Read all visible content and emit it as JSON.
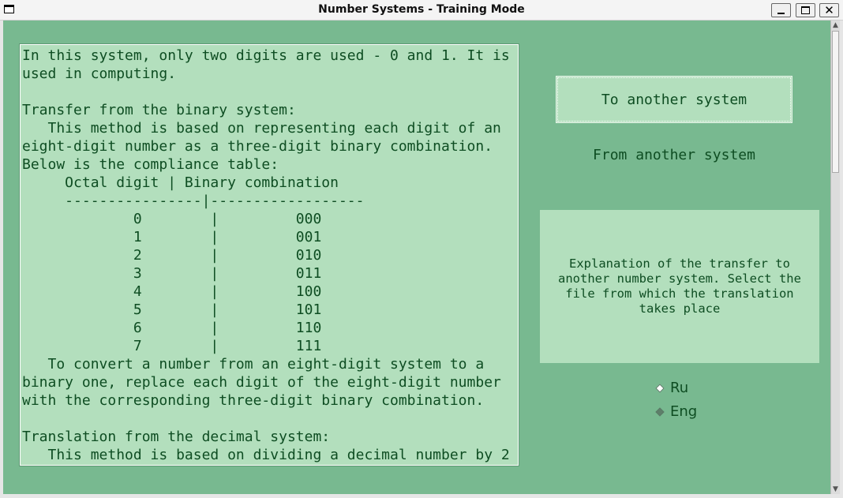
{
  "window": {
    "title": "Number Systems - Training Mode",
    "close_glyph": "✕"
  },
  "content": {
    "text": "In this system, only two digits are used - 0 and 1. It is\nused in computing.\n\nTransfer from the binary system:\n   This method is based on representing each digit of an\neight-digit number as a three-digit binary combination.\nBelow is the compliance table:\n     Octal digit | Binary combination\n     ----------------|------------------\n             0        |         000\n             1        |         001\n             2        |         010\n             3        |         011\n             4        |         100\n             5        |         101\n             6        |         110\n             7        |         111\n   To convert a number from an eight-digit system to a\nbinary one, replace each digit of the eight-digit number\nwith the corresponding three-digit binary combination.\n\nTranslation from the decimal system:\n   This method is based on dividing a decimal number by 2"
  },
  "buttons": {
    "to_another": "To another system",
    "from_another": "From another system"
  },
  "explanation": "Explanation of the transfer to another number system. Select the file from which the translation takes place",
  "language": {
    "options": [
      {
        "label": "Ru",
        "selected": false
      },
      {
        "label": "Eng",
        "selected": true
      }
    ]
  },
  "colors": {
    "background": "#78b990",
    "panel": "#b3dfbd",
    "text": "#0e4d22"
  }
}
